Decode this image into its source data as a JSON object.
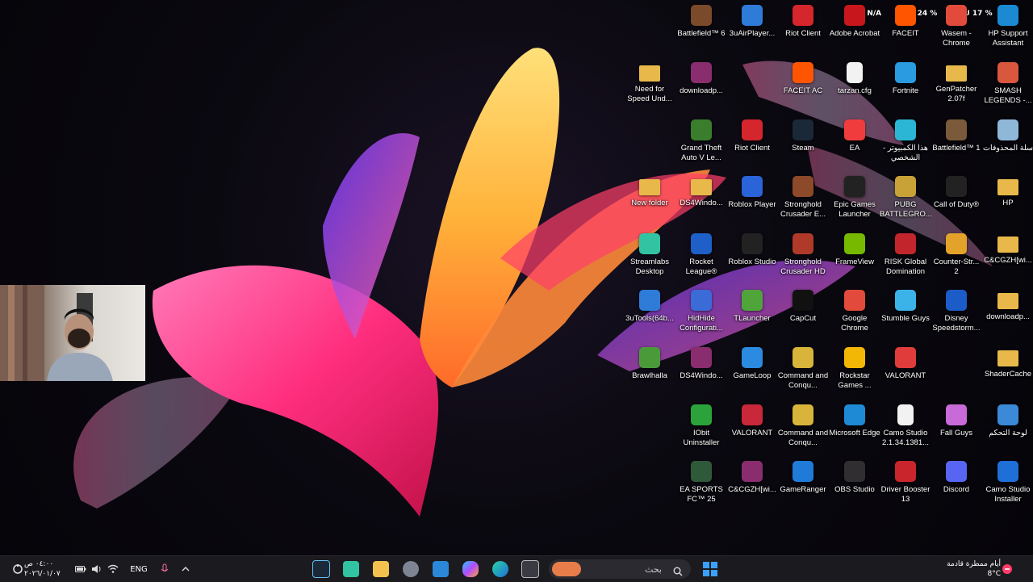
{
  "overlay": {
    "fps": "FPS N/A",
    "gpu": "GPU 24 %",
    "cpu": "CPU 17 %"
  },
  "desktop_icons": [
    {
      "label": "Battlefield™ 6",
      "icon": "battlefield-icon",
      "color": "#7a4a2a"
    },
    {
      "label": "3uAirPlayer...",
      "icon": "3uairplayer-icon",
      "color": "#2f7bd8"
    },
    {
      "label": "Riot Client",
      "icon": "riot-client-icon",
      "color": "#d4262c"
    },
    {
      "label": "Adobe Acrobat",
      "icon": "adobe-acrobat-icon",
      "color": "#c8161d"
    },
    {
      "label": "FACEIT",
      "icon": "faceit-icon",
      "color": "#ff5500"
    },
    {
      "label": "Wasem - Chrome",
      "icon": "chrome-icon",
      "color": "#e24b3b"
    },
    {
      "label": "HP Support Assistant",
      "icon": "hp-support-icon",
      "color": "#1b8ad3"
    },
    {
      "label": "Need for Speed Und...",
      "icon": "folder-icon",
      "color": "#e8b94a"
    },
    {
      "label": "downloadp...",
      "icon": "winrar-icon",
      "color": "#8a2d6e"
    },
    {
      "label": "FACEIT AC",
      "icon": "faceit-ac-icon",
      "color": "#ff5500"
    },
    {
      "label": "tarzan.cfg",
      "icon": "file-icon",
      "color": "#f2f2f2"
    },
    {
      "label": "Fortnite",
      "icon": "fortnite-icon",
      "color": "#2a9be0"
    },
    {
      "label": "GenPatcher 2.07f",
      "icon": "folder-icon",
      "color": "#e8b94a"
    },
    {
      "label": "SMASH LEGENDS -...",
      "icon": "smash-legends-icon",
      "color": "#d9583d"
    },
    {
      "label": "Grand Theft Auto V Le...",
      "icon": "gta-v-icon",
      "color": "#3a7d2c"
    },
    {
      "label": "Riot Client",
      "icon": "riot-client-icon",
      "color": "#d4262c"
    },
    {
      "label": "Steam",
      "icon": "steam-icon",
      "color": "#1b2838"
    },
    {
      "label": "EA",
      "icon": "ea-icon",
      "color": "#f03c3c"
    },
    {
      "label": "هذا الكمبيوتر - الشخصي",
      "icon": "this-pc-icon",
      "color": "#2bb6d6"
    },
    {
      "label": "Battlefield™ 1",
      "icon": "battlefield-icon",
      "color": "#7a5a3a"
    },
    {
      "label": "سلة المحذوفات",
      "icon": "recycle-bin-icon",
      "color": "#8fb8d8"
    },
    {
      "label": "New folder",
      "icon": "folder-icon",
      "color": "#e8b94a"
    },
    {
      "label": "DS4Windo...",
      "icon": "folder-icon",
      "color": "#e8b94a"
    },
    {
      "label": "Roblox Player",
      "icon": "roblox-icon",
      "color": "#2a64d8"
    },
    {
      "label": "Stronghold Crusader E...",
      "icon": "stronghold-icon",
      "color": "#8c4a2a"
    },
    {
      "label": "Epic Games Launcher",
      "icon": "epic-games-icon",
      "color": "#222222"
    },
    {
      "label": "PUBG BATTLEGRO...",
      "icon": "pubg-icon",
      "color": "#c8a236"
    },
    {
      "label": "Call of Duty®",
      "icon": "call-of-duty-icon",
      "color": "#222222"
    },
    {
      "label": "HP",
      "icon": "folder-icon",
      "color": "#e8b94a"
    },
    {
      "label": "Streamlabs Desktop",
      "icon": "streamlabs-icon",
      "color": "#31c3a2"
    },
    {
      "label": "Rocket League®",
      "icon": "rocket-league-icon",
      "color": "#1f5fc8"
    },
    {
      "label": "Roblox Studio",
      "icon": "roblox-studio-icon",
      "color": "#222222"
    },
    {
      "label": "Stronghold Crusader HD",
      "icon": "stronghold-icon",
      "color": "#b03a2a"
    },
    {
      "label": "FrameView",
      "icon": "frameview-icon",
      "color": "#76b900"
    },
    {
      "label": "RISK Global Domination",
      "icon": "risk-icon",
      "color": "#c2262c"
    },
    {
      "label": "Counter-Str... 2",
      "icon": "counter-strike-icon",
      "color": "#e3a22a"
    },
    {
      "label": "C&CGZH[wi...",
      "icon": "folder-icon",
      "color": "#e8b94a"
    },
    {
      "label": "3uTools(64b...",
      "icon": "3utools-icon",
      "color": "#2f7bd8"
    },
    {
      "label": "HidHide Configurati...",
      "icon": "hidhide-icon",
      "color": "#3b6bd6"
    },
    {
      "label": "TLauncher",
      "icon": "tlauncher-icon",
      "color": "#4fa43a"
    },
    {
      "label": "CapCut",
      "icon": "capcut-icon",
      "color": "#111111"
    },
    {
      "label": "Google Chrome",
      "icon": "chrome-icon",
      "color": "#e24b3b"
    },
    {
      "label": "Stumble Guys",
      "icon": "stumble-guys-icon",
      "color": "#3cb3e8"
    },
    {
      "label": "Disney Speedstorm...",
      "icon": "disney-speedstorm-icon",
      "color": "#1c5cc8"
    },
    {
      "label": "downloadp...",
      "icon": "folder-icon",
      "color": "#e8b94a"
    },
    {
      "label": "Brawlhalla",
      "icon": "brawlhalla-icon",
      "color": "#4a9a3a"
    },
    {
      "label": "DS4Windo...",
      "icon": "winrar-icon",
      "color": "#8a2d6e"
    },
    {
      "label": "GameLoop",
      "icon": "gameloop-icon",
      "color": "#2a8be0"
    },
    {
      "label": "Command and Conqu...",
      "icon": "command-conquer-icon",
      "color": "#d8b43a"
    },
    {
      "label": "Rockstar Games ...",
      "icon": "rockstar-icon",
      "color": "#f2b705"
    },
    {
      "label": "VALORANT",
      "icon": "valorant-icon",
      "color": "#e03c3c"
    },
    {
      "label": "ShaderCache",
      "icon": "folder-icon",
      "color": "#e8b94a"
    },
    {
      "label": "IObit Uninstaller",
      "icon": "iobit-icon",
      "color": "#2ca33a"
    },
    {
      "label": "VALORANT",
      "icon": "valorant-icon",
      "color": "#c8283a"
    },
    {
      "label": "Command and Conqu...",
      "icon": "command-conquer-icon",
      "color": "#d8b43a"
    },
    {
      "label": "Microsoft Edge",
      "icon": "edge-icon",
      "color": "#1e8ad6"
    },
    {
      "label": "Camo Studio 2.1.34.1381...",
      "icon": "file-icon",
      "color": "#f2f2f2"
    },
    {
      "label": "Fall Guys",
      "icon": "fall-guys-icon",
      "color": "#c86ad8"
    },
    {
      "label": "لوحة التحكم",
      "icon": "control-panel-icon",
      "color": "#3a8ad8"
    },
    {
      "label": "EA SPORTS FC™ 25",
      "icon": "ea-fc-icon",
      "color": "#2f5a3a"
    },
    {
      "label": "C&CGZH[wi...",
      "icon": "winrar-icon",
      "color": "#8a2d6e"
    },
    {
      "label": "GameRanger",
      "icon": "gameranger-icon",
      "color": "#1f7ad8"
    },
    {
      "label": "OBS Studio",
      "icon": "obs-icon",
      "color": "#302e31"
    },
    {
      "label": "Driver Booster 13",
      "icon": "driver-booster-icon",
      "color": "#c8262c"
    },
    {
      "label": "Discord",
      "icon": "discord-icon",
      "color": "#5865f2"
    },
    {
      "label": "Camo Studio Installer",
      "icon": "camo-installer-icon",
      "color": "#1e6fd8"
    }
  ],
  "taskbar": {
    "clock": {
      "time": "٠٤:٠٠ ص",
      "date": "٢٠٢٦/٠١/٠٧"
    },
    "language": "ENG",
    "search_placeholder": "بحث",
    "weather": {
      "text": "أيام ممطرة قادمة",
      "temp": "8°C"
    },
    "apps": [
      "steam-icon",
      "streamlabs-icon",
      "file-explorer-icon",
      "settings-icon",
      "microsoft-store-icon",
      "copilot-icon",
      "edge-icon",
      "task-view-icon",
      "start-icon"
    ]
  }
}
